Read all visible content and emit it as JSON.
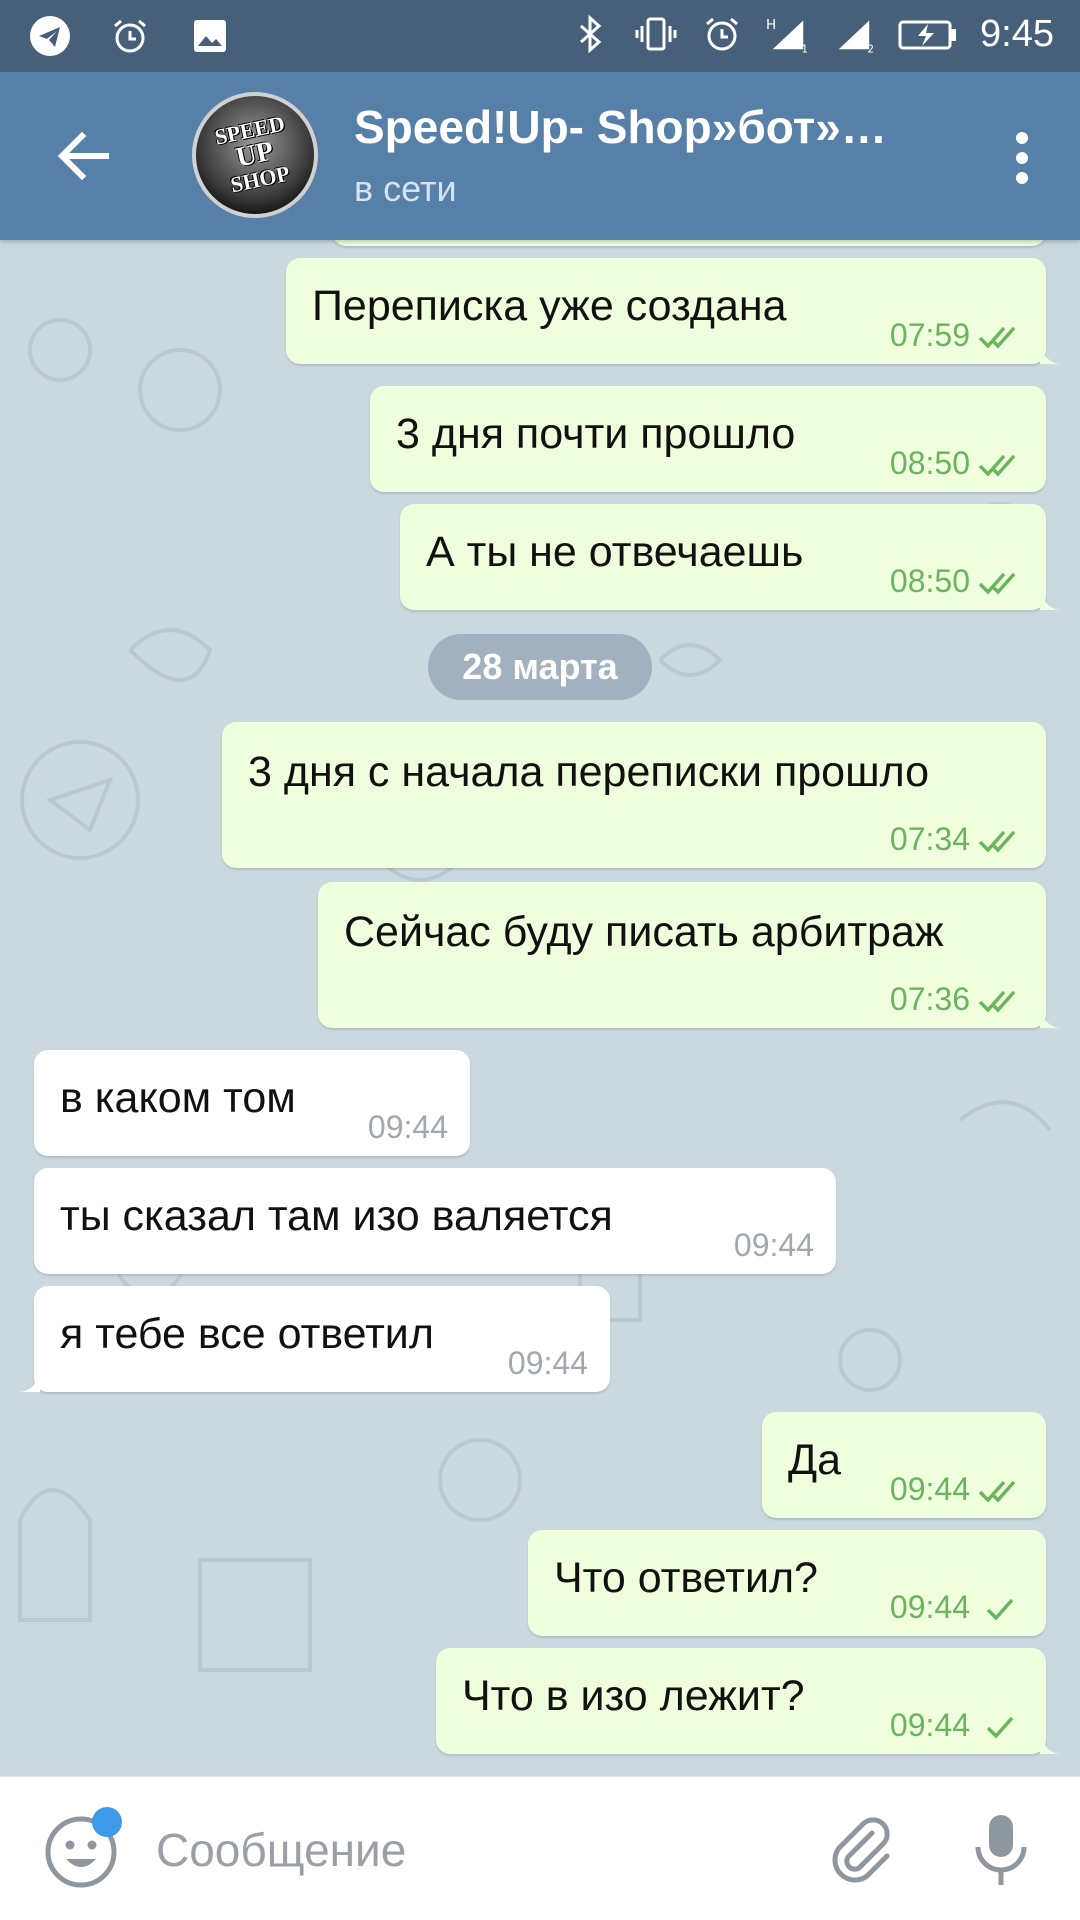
{
  "status_bar": {
    "time": "9:45",
    "left_icons": [
      "telegram-icon",
      "alarm-icon",
      "image-icon"
    ],
    "right_icons": [
      "bluetooth-icon",
      "vibrate-icon",
      "alarm-icon",
      "signal-sim1-icon",
      "signal-sim2-icon",
      "battery-charging-icon"
    ],
    "network_label": "H"
  },
  "header": {
    "title": "Speed!Up- Shop»бот»…",
    "status": "в сети",
    "avatar_text": [
      "SPEED",
      "UP",
      "SHOP"
    ]
  },
  "messages": [
    {
      "dir": "out",
      "text": "Переписка уже создана",
      "time": "07:59",
      "ticks": "double"
    },
    {
      "dir": "out",
      "text": "3 дня почти прошло",
      "time": "08:50",
      "ticks": "double"
    },
    {
      "dir": "out",
      "text": "А ты не отвечаешь",
      "time": "08:50",
      "ticks": "double"
    },
    {
      "dir": "out",
      "text": "3 дня с начала переписки прошло",
      "time": "07:34",
      "ticks": "double"
    },
    {
      "dir": "out",
      "text": "Сейчас буду писать арбитраж",
      "time": "07:36",
      "ticks": "double"
    },
    {
      "dir": "in",
      "text": "в каком том",
      "time": "09:44"
    },
    {
      "dir": "in",
      "text": "ты сказал там  изо валяется",
      "time": "09:44"
    },
    {
      "dir": "in",
      "text": "я тебе все ответил",
      "time": "09:44"
    },
    {
      "dir": "out",
      "text": "Да",
      "time": "09:44",
      "ticks": "double"
    },
    {
      "dir": "out",
      "text": "Что ответил?",
      "time": "09:44",
      "ticks": "single"
    },
    {
      "dir": "out",
      "text": "Что в изо лежит?",
      "time": "09:44",
      "ticks": "single"
    }
  ],
  "date_separator": "28 марта",
  "input": {
    "placeholder": "Сообщение",
    "value": ""
  },
  "colors": {
    "header": "#5680a8",
    "status_bar": "#47607a",
    "outgoing_bubble": "#effedd",
    "incoming_bubble": "#ffffff",
    "tick_green": "#6bb35e",
    "wallpaper": "#cbd8e0"
  }
}
